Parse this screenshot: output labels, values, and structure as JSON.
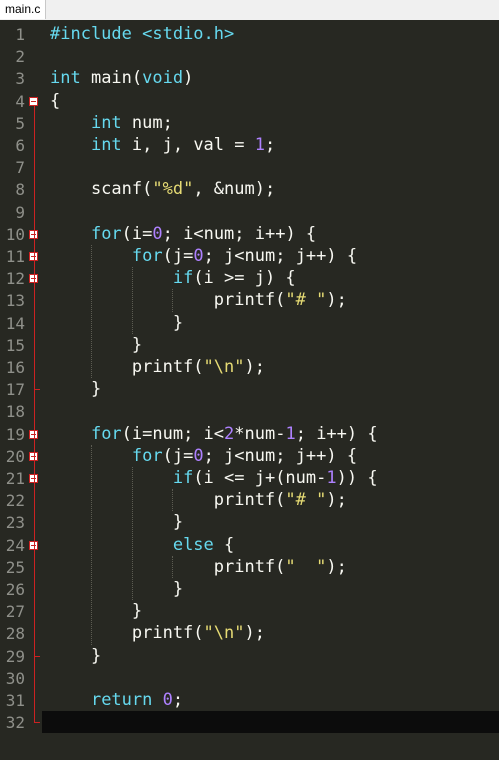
{
  "tab": {
    "label": "main.c"
  },
  "lines": [
    {
      "n": "1",
      "tokens": [
        [
          "#include ",
          "pp"
        ],
        [
          "<stdio.h>",
          "pp"
        ]
      ]
    },
    {
      "n": "2",
      "tokens": []
    },
    {
      "n": "3",
      "tokens": [
        [
          "int",
          "kw"
        ],
        [
          " main(",
          "plain"
        ],
        [
          "void",
          "kw"
        ],
        [
          ")",
          "plain"
        ]
      ]
    },
    {
      "n": "4",
      "tokens": [
        [
          "{",
          "plain"
        ]
      ]
    },
    {
      "n": "5",
      "tokens": [
        [
          "    ",
          "plain"
        ],
        [
          "int",
          "kw"
        ],
        [
          " num;",
          "plain"
        ]
      ]
    },
    {
      "n": "6",
      "tokens": [
        [
          "    ",
          "plain"
        ],
        [
          "int",
          "kw"
        ],
        [
          " i, j, val = ",
          "plain"
        ],
        [
          "1",
          "num"
        ],
        [
          ";",
          "plain"
        ]
      ]
    },
    {
      "n": "7",
      "tokens": []
    },
    {
      "n": "8",
      "tokens": [
        [
          "    scanf(",
          "plain"
        ],
        [
          "\"%d\"",
          "str"
        ],
        [
          ", &num);",
          "plain"
        ]
      ]
    },
    {
      "n": "9",
      "tokens": []
    },
    {
      "n": "10",
      "tokens": [
        [
          "    ",
          "plain"
        ],
        [
          "for",
          "kw"
        ],
        [
          "(i=",
          "plain"
        ],
        [
          "0",
          "num"
        ],
        [
          "; i<num; i++) {",
          "plain"
        ]
      ]
    },
    {
      "n": "11",
      "tokens": [
        [
          "        ",
          "plain"
        ],
        [
          "for",
          "kw"
        ],
        [
          "(j=",
          "plain"
        ],
        [
          "0",
          "num"
        ],
        [
          "; j<num; j++) {",
          "plain"
        ]
      ]
    },
    {
      "n": "12",
      "tokens": [
        [
          "            ",
          "plain"
        ],
        [
          "if",
          "kw"
        ],
        [
          "(i >= j) {",
          "plain"
        ]
      ]
    },
    {
      "n": "13",
      "tokens": [
        [
          "                printf(",
          "plain"
        ],
        [
          "\"# \"",
          "str"
        ],
        [
          ");",
          "plain"
        ]
      ]
    },
    {
      "n": "14",
      "tokens": [
        [
          "            }",
          "plain"
        ]
      ]
    },
    {
      "n": "15",
      "tokens": [
        [
          "        }",
          "plain"
        ]
      ]
    },
    {
      "n": "16",
      "tokens": [
        [
          "        printf(",
          "plain"
        ],
        [
          "\"\\n\"",
          "str"
        ],
        [
          ");",
          "plain"
        ]
      ]
    },
    {
      "n": "17",
      "tokens": [
        [
          "    }",
          "plain"
        ]
      ]
    },
    {
      "n": "18",
      "tokens": []
    },
    {
      "n": "19",
      "tokens": [
        [
          "    ",
          "plain"
        ],
        [
          "for",
          "kw"
        ],
        [
          "(i=num; i<",
          "plain"
        ],
        [
          "2",
          "num"
        ],
        [
          "*num-",
          "plain"
        ],
        [
          "1",
          "num"
        ],
        [
          "; i++) {",
          "plain"
        ]
      ]
    },
    {
      "n": "20",
      "tokens": [
        [
          "        ",
          "plain"
        ],
        [
          "for",
          "kw"
        ],
        [
          "(j=",
          "plain"
        ],
        [
          "0",
          "num"
        ],
        [
          "; j<num; j++) {",
          "plain"
        ]
      ]
    },
    {
      "n": "21",
      "tokens": [
        [
          "            ",
          "plain"
        ],
        [
          "if",
          "kw"
        ],
        [
          "(i <= j+(num-",
          "plain"
        ],
        [
          "1",
          "num"
        ],
        [
          ")) {",
          "plain"
        ]
      ]
    },
    {
      "n": "22",
      "tokens": [
        [
          "                printf(",
          "plain"
        ],
        [
          "\"# \"",
          "str"
        ],
        [
          ");",
          "plain"
        ]
      ]
    },
    {
      "n": "23",
      "tokens": [
        [
          "            }",
          "plain"
        ]
      ]
    },
    {
      "n": "24",
      "tokens": [
        [
          "            ",
          "plain"
        ],
        [
          "else",
          "kw"
        ],
        [
          " {",
          "plain"
        ]
      ]
    },
    {
      "n": "25",
      "tokens": [
        [
          "                printf(",
          "plain"
        ],
        [
          "\"  \"",
          "str"
        ],
        [
          ");",
          "plain"
        ]
      ]
    },
    {
      "n": "26",
      "tokens": [
        [
          "            }",
          "plain"
        ]
      ]
    },
    {
      "n": "27",
      "tokens": [
        [
          "        }",
          "plain"
        ]
      ]
    },
    {
      "n": "28",
      "tokens": [
        [
          "        printf(",
          "plain"
        ],
        [
          "\"\\n\"",
          "str"
        ],
        [
          ");",
          "plain"
        ]
      ]
    },
    {
      "n": "29",
      "tokens": [
        [
          "    }",
          "plain"
        ]
      ]
    },
    {
      "n": "30",
      "tokens": []
    },
    {
      "n": "31",
      "tokens": [
        [
          "    ",
          "plain"
        ],
        [
          "return",
          "kw"
        ],
        [
          " ",
          "plain"
        ],
        [
          "0",
          "num"
        ],
        [
          ";",
          "plain"
        ]
      ]
    },
    {
      "n": "32",
      "tokens": [
        [
          "}",
          "plain"
        ]
      ]
    }
  ],
  "folds": [
    "4",
    "10",
    "11",
    "12",
    "19",
    "20",
    "21",
    "24"
  ],
  "current_line": "32",
  "colors": {
    "background": "#272822",
    "keyword": "#66d9ef",
    "string": "#e6db74",
    "number": "#ae81ff",
    "text": "#f8f8f2",
    "line_number": "#8f908a",
    "fold_marker": "#cc2222"
  }
}
